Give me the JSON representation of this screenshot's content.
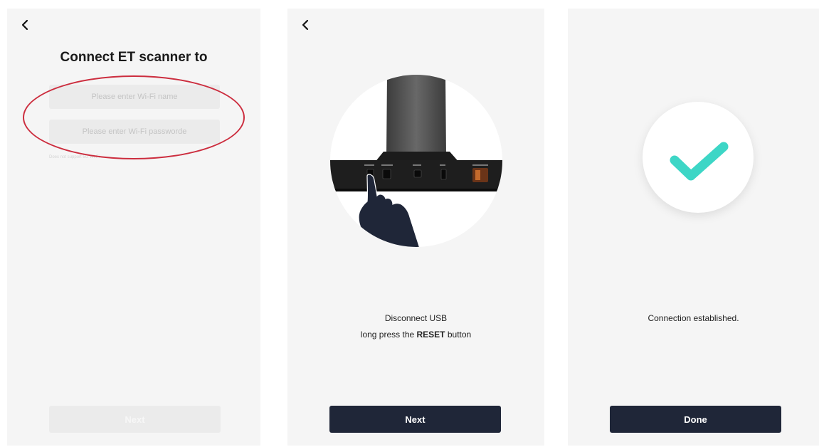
{
  "screen1": {
    "title": "Connect ET scanner to",
    "wifi_name_placeholder": "Please enter Wi-Fi name",
    "wifi_password_placeholder": "Please enter Wi-Fi passworde",
    "hint": "Does not support 5G Wi-Fi",
    "next_label": "Next"
  },
  "screen2": {
    "instruction_line1": "Disconnect USB",
    "instruction_prefix": "long press the ",
    "instruction_bold": "RESET",
    "instruction_suffix": " button",
    "next_label": "Next"
  },
  "screen3": {
    "message": "Connection established.",
    "done_label": "Done"
  },
  "colors": {
    "screen_bg": "#f5f5f5",
    "button_dark": "#1f2638",
    "button_disabled": "#ebebeb",
    "highlight_oval": "#cc2d3e",
    "check_teal": "#3dd6c6"
  },
  "icons": [
    "back-arrow-icon",
    "checkmark-icon"
  ]
}
